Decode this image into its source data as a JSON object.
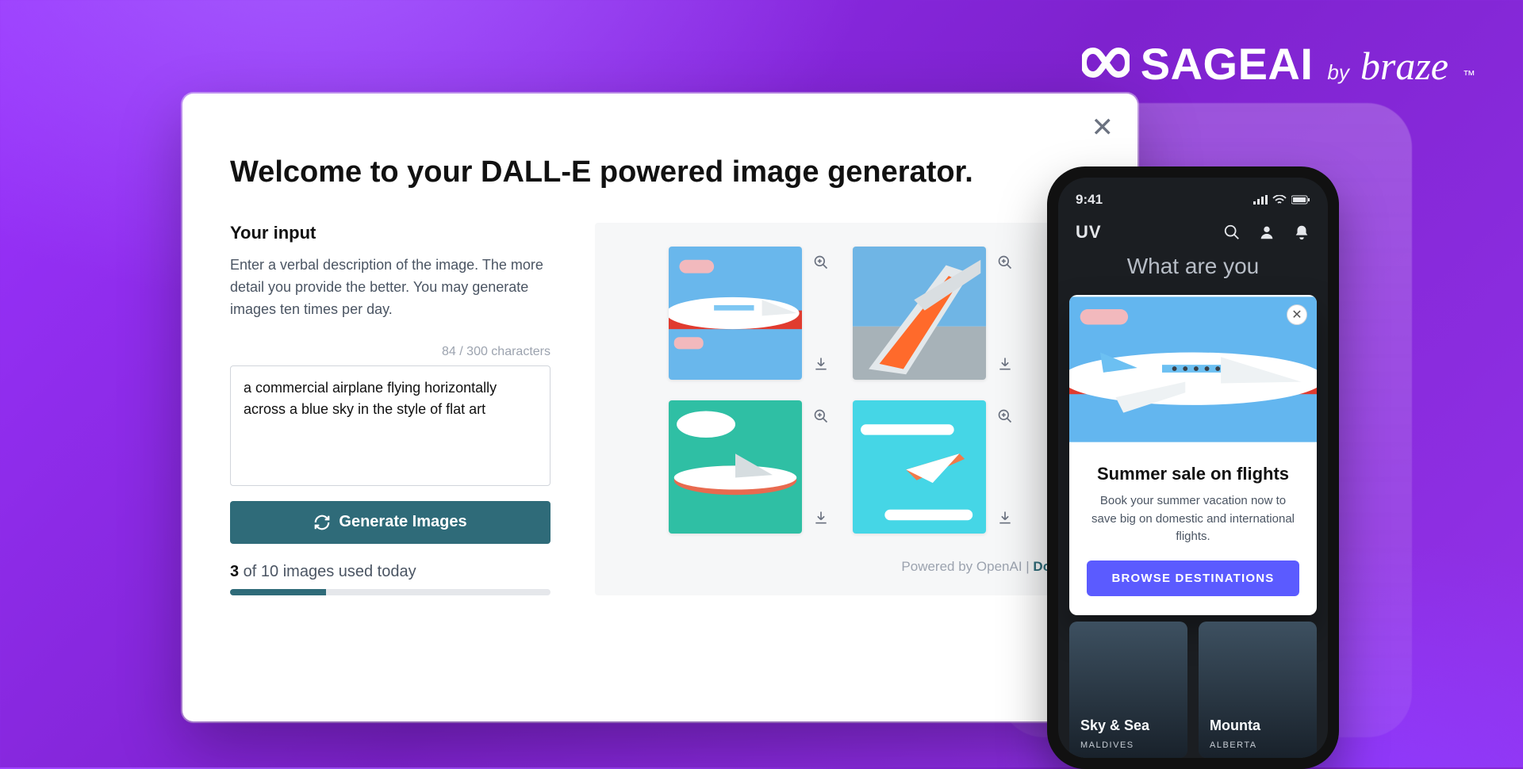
{
  "brand": {
    "sage": "SAGEAI",
    "by": "by",
    "braze": "braze",
    "tm": "™"
  },
  "generator": {
    "close_glyph": "✕",
    "title": "Welcome to your DALL-E powered image generator.",
    "subhead": "Your input",
    "help": "Enter a verbal description of the image. The more detail you provide the better. You may generate images ten times per day.",
    "char_count": "84 / 300 characters",
    "prompt_value": "a commercial airplane flying horizontally across a blue sky in the style of flat art",
    "button_label": "Generate Images",
    "usage_prefix_count": "3",
    "usage_rest": " of 10 images used today",
    "usage_pct": 30,
    "powered_prefix": "Powered by OpenAI | ",
    "docs_link": "Docs"
  },
  "gallery_tiles": [
    {
      "desc": "white-red jet on light blue sky with pink clouds, facing right"
    },
    {
      "desc": "orange jet close-up ascending over grey runway and blue sky"
    },
    {
      "desc": "red-white jet descending over teal water with white cloud"
    },
    {
      "desc": "small white jet over cyan sky with long white clouds"
    }
  ],
  "phone": {
    "time": "9:41",
    "app_logo": "UV",
    "hero": "What are you",
    "iam": {
      "title": "Summer sale on flights",
      "sub": "Book your summer vacation now to save big on domestic and international flights.",
      "cta": "BROWSE DESTINATIONS",
      "close": "✕"
    },
    "destinations": [
      {
        "title": "Sky & Sea",
        "sub": "MALDIVES"
      },
      {
        "title": "Mounta",
        "sub": "ALBERTA"
      }
    ]
  }
}
